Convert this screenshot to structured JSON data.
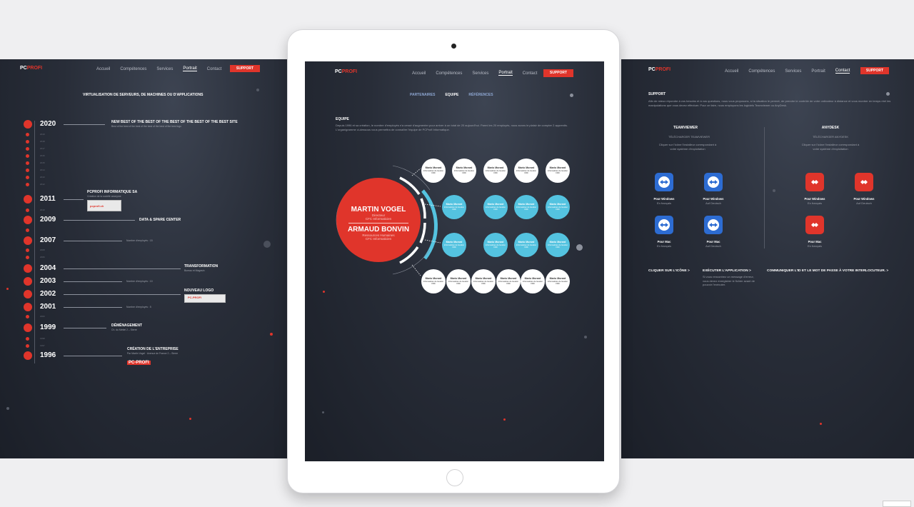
{
  "brand": {
    "pc": "PC",
    "profi": "PROFI",
    "accent": "#e0352b",
    "cyan": "#54c3e0"
  },
  "nav": {
    "items": [
      "Accueil",
      "Compétences",
      "Services",
      "Portrait",
      "Contact"
    ],
    "active": "Portrait",
    "support": "SUPPORT"
  },
  "left": {
    "title": "VIRTUALISATION DE SERVEURS, DE MACHINES OU D'APPLICATIONS",
    "entries": [
      {
        "year": "2020",
        "title": "NEW BEST OF THE BEST OF THE BEST OF THE BEST OF THE BEST SITE",
        "sub": "Best of the best of the best of the best of the best of the best logo"
      },
      {
        "year": "2011",
        "title": "PCPROFI INFORMATIQUE SA",
        "sub": "Création de la société anonyme"
      },
      {
        "year": "2009",
        "title": "DATA & SPARE CENTER",
        "sub": ""
      },
      {
        "year": "2007",
        "title": "",
        "sub": "Nombre d'employés : 15"
      },
      {
        "year": "2004",
        "title": "TRANSFORMATION",
        "sub": "Bureau et Magasin"
      },
      {
        "year": "2003",
        "title": "",
        "sub": "Nombre d'employés : 10"
      },
      {
        "year": "2002",
        "title": "NOUVEAU LOGO",
        "sub": ""
      },
      {
        "year": "2001",
        "title": "",
        "sub": "Nombre d'employés : 5"
      },
      {
        "year": "1999",
        "title": "DÉMÉNAGEMENT",
        "sub": "Ch. du Mettel 2 – Sierre"
      },
      {
        "year": "1996",
        "title": "CRÉATION DE L'ENTREPRISE",
        "sub": "Par Martin Vogel · Avenue de France 2 – Sierre"
      }
    ],
    "minor_years": [
      "2019",
      "2018",
      "2017",
      "2016",
      "2015",
      "2014",
      "2013",
      "2012",
      "2010",
      "2008",
      "2006",
      "2005",
      "2000",
      "1998",
      "1997"
    ],
    "stamp_2011": "pcprofi.ch",
    "stamp_2002": "PC-PROFI",
    "stamp_1996": "PC-PROFI"
  },
  "center": {
    "tabs": [
      "PARTENAIRES",
      "EQUIPE",
      "RÉFÉRENCES"
    ],
    "active_tab": "EQUIPE",
    "section_title": "EQUIPE",
    "intro": "Depuis 1996 et sa création, le nombre d'employés n'a cessé d'augmenter pour arriver à un total de 20 aujourd'hui. Parmi les 20 employés, nous avons le plaisir de compter 2 apprentis. L'organigramme ci-dessous vous permettra de connaître l'équipe de PCProfi Informatique.",
    "leaders": [
      {
        "name": "MARTIN VOGEL",
        "role1": "Directeur",
        "role2": "CFC Informaticien"
      },
      {
        "name": "ARMAUD BONVIN",
        "role1": "Ressources Humaines",
        "role2": "CFC Informaticien"
      }
    ],
    "member_name": "Mario Morard",
    "member_role": "Informaticien de Gestion FRD"
  },
  "right": {
    "title": "SUPPORT",
    "intro": "Afin de mieux répondre à vos besoins et à vos questions, nous vous proposons, si la situation le permet, de prendre le contrôle de votre ordinateur à distance et vous montrer en temps réel les manipulations que vous devez effectuer. Pour ce faire, nous employons les logiciels Teamviewer ou AnyDesk.",
    "teamviewer": {
      "title": "TEAMVIEWER",
      "dl": "TÉLÉCHARGER TEAMVIEWER",
      "hint": "Cliquer sur l'icône l'installeur correspondant à votre système d'exploitation"
    },
    "anydesk": {
      "title": "ANYDESK",
      "dl": "TÉLÉCHARGER ANYDESK",
      "hint": "Cliquer sur l'icône l'installeur correspondant à votre système d'exploitation"
    },
    "apps": [
      {
        "label": "Pour Windows",
        "sub": "En français"
      },
      {
        "label": "Pour Windows",
        "sub": "Auf Deutsch"
      },
      {
        "label": "Pour Mac",
        "sub": "En français"
      },
      {
        "label": "Pour Mac",
        "sub": "Auf Deutsch"
      }
    ],
    "steps": [
      {
        "title": "CLIQUER SUR L'ICÔNE >",
        "text": ""
      },
      {
        "title": "EXÉCUTER L'APPLICATION >",
        "text": "Si vous rencontrez un message d'erreur, vous devez enregistrer le fichier avant de pouvoir l'exécuter."
      },
      {
        "title": "COMMUNIQUER L'ID ET LE MOT DE PASSE À VOTRE INTERLOCUTEUR. >",
        "text": ""
      }
    ]
  }
}
